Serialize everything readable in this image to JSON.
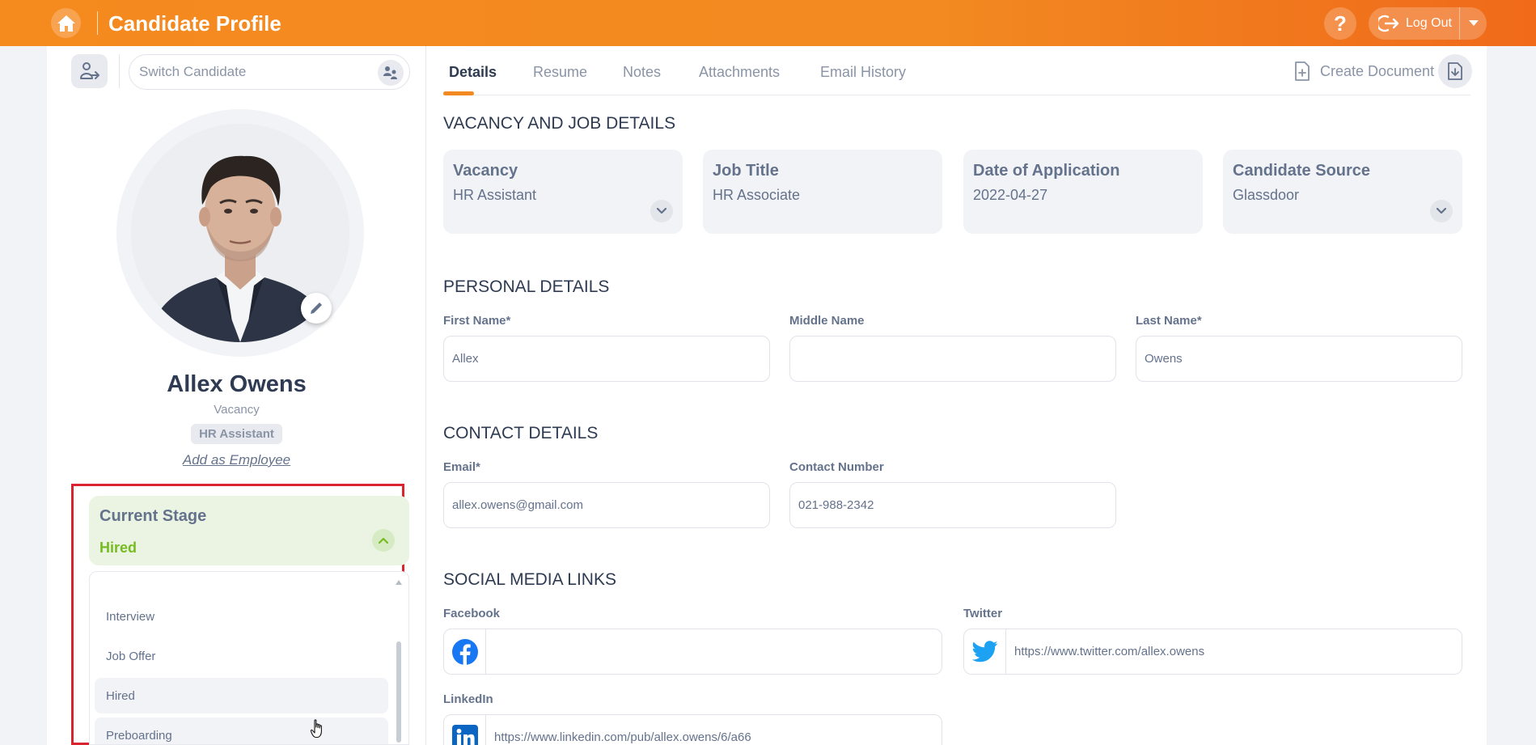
{
  "header": {
    "title": "Candidate Profile",
    "help_label": "?",
    "logout_label": "Log Out"
  },
  "sidebar": {
    "switch_placeholder": "Switch Candidate",
    "candidate_name": "Allex Owens",
    "vacancy_label": "Vacancy",
    "vacancy_value": "HR Assistant",
    "add_employee_label": "Add as Employee",
    "current_stage_label": "Current Stage",
    "current_stage_value": "Hired",
    "stage_options": [
      "Interview",
      "Job Offer",
      "Hired",
      "Preboarding"
    ],
    "selected_stage": "Hired"
  },
  "tabs": [
    "Details",
    "Resume",
    "Notes",
    "Attachments",
    "Email History"
  ],
  "active_tab": "Details",
  "create_document_label": "Create Document",
  "vacancy_section": {
    "title": "VACANCY AND JOB DETAILS",
    "cards": [
      {
        "label": "Vacancy",
        "value": "HR Assistant"
      },
      {
        "label": "Job Title",
        "value": "HR Associate"
      },
      {
        "label": "Date of Application",
        "value": "2022-04-27"
      },
      {
        "label": "Candidate Source",
        "value": "Glassdoor"
      }
    ]
  },
  "personal_section": {
    "title": "PERSONAL DETAILS",
    "first_name_label": "First Name*",
    "first_name_value": "Allex",
    "middle_name_label": "Middle Name",
    "middle_name_value": "",
    "last_name_label": "Last Name*",
    "last_name_value": "Owens"
  },
  "contact_section": {
    "title": "CONTACT DETAILS",
    "email_label": "Email*",
    "email_value": "allex.owens@gmail.com",
    "contact_label": "Contact Number",
    "contact_value": "021-988-2342"
  },
  "social_section": {
    "title": "SOCIAL MEDIA LINKS",
    "facebook_label": "Facebook",
    "facebook_value": "",
    "twitter_label": "Twitter",
    "twitter_value": "https://www.twitter.com/allex.owens",
    "linkedin_label": "LinkedIn",
    "linkedin_value": "https://www.linkedin.com/pub/allex.owens/6/a66"
  },
  "colors": {
    "brand_orange": "#f28a21",
    "stage_green": "#76bc21",
    "stage_bg": "#ebf4e2",
    "highlight_red": "#d9232e",
    "facebook_blue": "#1877f2",
    "twitter_blue": "#1da1f2",
    "linkedin_blue": "#0a66c2"
  },
  "icons": [
    "home-icon",
    "help-icon",
    "logout-icon",
    "chevron-down-icon",
    "collapse-sidebar-icon",
    "switch-candidate-icon",
    "pencil-icon",
    "chevron-up-icon",
    "create-document-icon",
    "download-icon",
    "facebook-icon",
    "twitter-icon",
    "linkedin-icon",
    "hand-cursor-icon"
  ]
}
